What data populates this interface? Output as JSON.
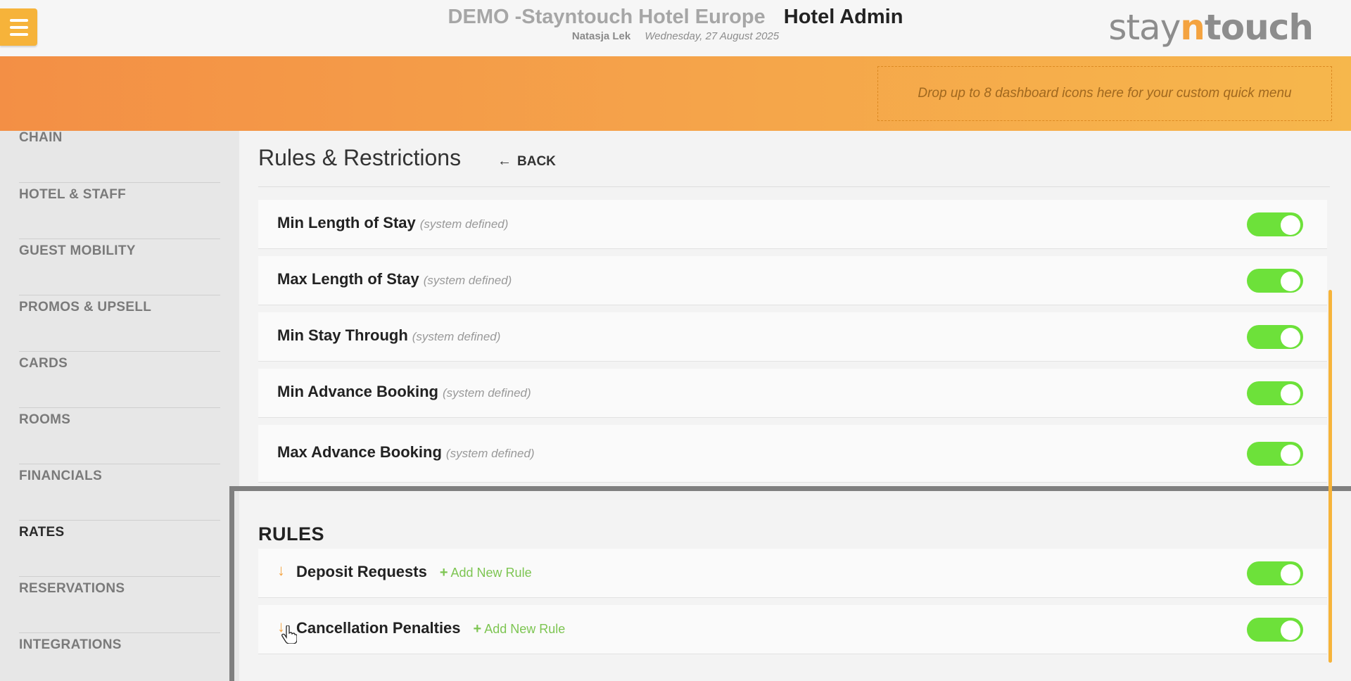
{
  "header": {
    "hotel_name": "DEMO -Stayntouch Hotel Europe",
    "app_name": "Hotel Admin",
    "user": "Natasja Lek",
    "date": "Wednesday, 27 August 2025",
    "logo": {
      "stay": "stay",
      "n": "n",
      "touch": "touch"
    },
    "menu_icon": "hamburger-menu-icon"
  },
  "banner": {
    "dropzone_text": "Drop up to 8 dashboard icons here for your custom quick menu"
  },
  "sidebar": {
    "items": [
      {
        "label": "CHAIN"
      },
      {
        "label": "HOTEL & STAFF"
      },
      {
        "label": "GUEST MOBILITY"
      },
      {
        "label": "PROMOS & UPSELL"
      },
      {
        "label": "CARDS"
      },
      {
        "label": "ROOMS"
      },
      {
        "label": "FINANCIALS"
      },
      {
        "label": "RATES",
        "active": true
      },
      {
        "label": "RESERVATIONS"
      },
      {
        "label": "INTEGRATIONS"
      }
    ]
  },
  "page": {
    "title": "Rules & Restrictions",
    "back_label": "BACK",
    "restrictions": [
      {
        "label": "Min Length of Stay",
        "note": "(system defined)",
        "enabled": true
      },
      {
        "label": "Max Length of Stay",
        "note": "(system defined)",
        "enabled": true
      },
      {
        "label": "Min Stay Through",
        "note": "(system defined)",
        "enabled": true
      },
      {
        "label": "Min Advance Booking",
        "note": "(system defined)",
        "enabled": true
      },
      {
        "label": "Max Advance Booking",
        "note": "(system defined)",
        "enabled": true
      }
    ],
    "rules_heading": "RULES",
    "rules": [
      {
        "label": "Deposit Requests",
        "add_label": "Add New Rule",
        "enabled": true
      },
      {
        "label": "Cancellation Penalties",
        "add_label": "Add New Rule",
        "enabled": true
      }
    ]
  },
  "colors": {
    "accent_orange": "#f6b33a",
    "toggle_on": "#6de13a",
    "add_rule_green": "#7dc552"
  }
}
